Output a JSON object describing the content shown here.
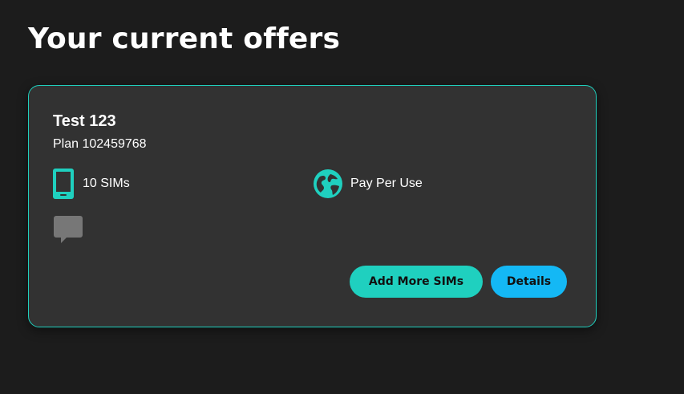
{
  "page": {
    "title": "Your current offers"
  },
  "offer": {
    "name": "Test 123",
    "plan": "Plan 102459768",
    "sims": "10 SIMs",
    "billing": "Pay Per Use",
    "icons": {
      "sims": "phone-icon",
      "billing": "globe-icon",
      "messaging": "chat-bubble-icon"
    },
    "actions": {
      "add_sims_label": "Add More SIMs",
      "details_label": "Details"
    }
  },
  "colors": {
    "background": "#1c1c1c",
    "card": "#323232",
    "accent_teal": "#1fd0bf",
    "accent_blue": "#14b8f5",
    "muted_icon": "#777777"
  }
}
